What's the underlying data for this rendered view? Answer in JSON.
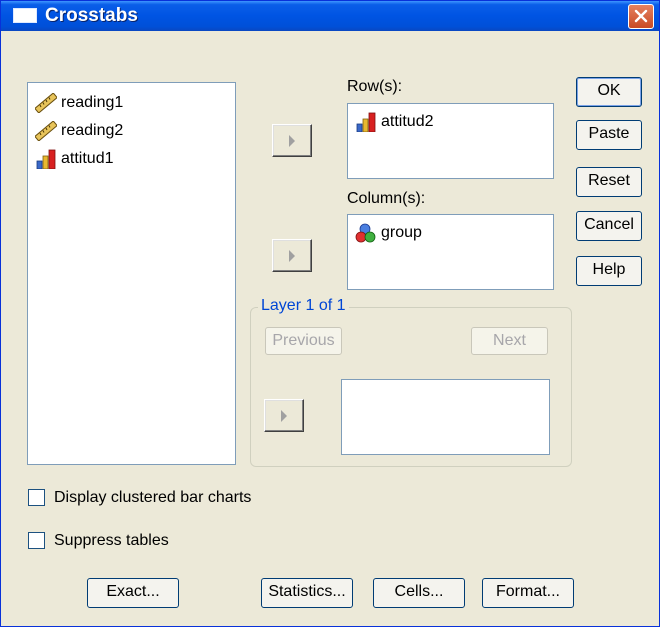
{
  "window": {
    "title": "Crosstabs"
  },
  "source_list": {
    "items": [
      {
        "label": "reading1",
        "icon": "ruler-icon"
      },
      {
        "label": "reading2",
        "icon": "ruler-icon"
      },
      {
        "label": "attitud1",
        "icon": "bar-chart-icon"
      }
    ]
  },
  "rows": {
    "label": "Row(s):",
    "items": [
      {
        "label": "attitud2",
        "icon": "bar-chart-icon"
      }
    ]
  },
  "columns": {
    "label": "Column(s):",
    "items": [
      {
        "label": "group",
        "icon": "nominal-circles-icon"
      }
    ]
  },
  "layer": {
    "title": "Layer 1 of 1",
    "previous": "Previous",
    "next": "Next"
  },
  "side_buttons": {
    "ok": "OK",
    "paste": "Paste",
    "reset": "Reset",
    "cancel": "Cancel",
    "help": "Help"
  },
  "options": {
    "clustered_bar": "Display clustered bar charts",
    "suppress": "Suppress tables"
  },
  "bottom_buttons": {
    "exact": "Exact...",
    "statistics": "Statistics...",
    "cells": "Cells...",
    "format": "Format..."
  },
  "colors": {
    "titlebar": "#0054e3",
    "dialog_bg": "#ece9d8",
    "close": "#c94a25",
    "layer_title": "#0046d5"
  }
}
